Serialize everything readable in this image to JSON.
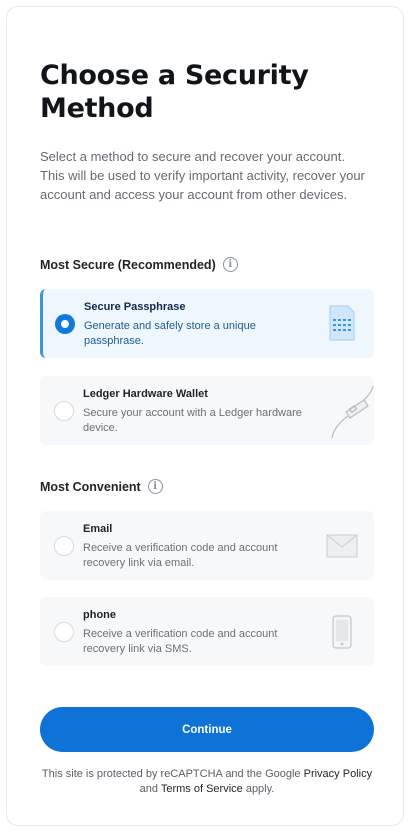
{
  "page": {
    "title": "Choose a Security Method",
    "description": "Select a method to secure and recover your account. This will be used to verify important activity, recover your account and access your account from other devices."
  },
  "sections": [
    {
      "heading": "Most Secure (Recommended)",
      "options": [
        {
          "title": "Secure Passphrase",
          "description": "Generate and safely store a unique passphrase.",
          "icon": "passphrase-document-icon",
          "selected": true
        },
        {
          "title": "Ledger Hardware Wallet",
          "description": "Secure your account with a Ledger hardware device.",
          "icon": "usb-device-icon",
          "selected": false
        }
      ]
    },
    {
      "heading": "Most Convenient",
      "options": [
        {
          "title": "Email",
          "description": "Receive a verification code and account recovery link via email.",
          "icon": "envelope-icon",
          "selected": false
        },
        {
          "title": "phone",
          "description": "Receive a verification code and account recovery link via SMS.",
          "icon": "smartphone-icon",
          "selected": false
        }
      ]
    }
  ],
  "continue_label": "Continue",
  "legal": {
    "prefix": "This site is protected by reCAPTCHA and the Google ",
    "privacy_label": "Privacy Policy",
    "and": " and ",
    "terms_label": "Terms of Service",
    "suffix": " apply."
  },
  "colors": {
    "accent": "#0e72d6",
    "selected_bg": "#eef6fe",
    "selected_border": "#3d95dc"
  }
}
